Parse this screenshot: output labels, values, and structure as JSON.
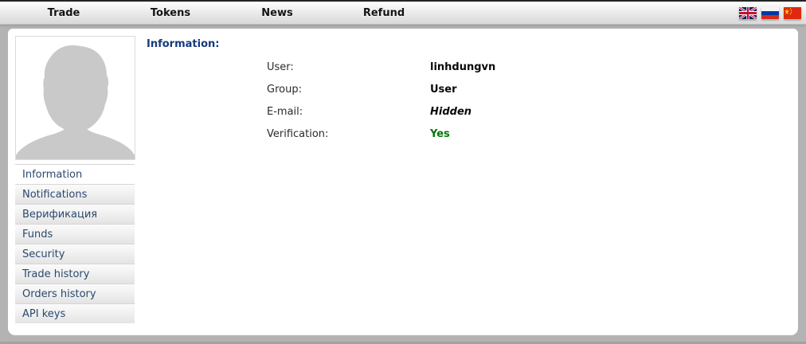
{
  "nav": {
    "items": [
      {
        "label": "Trade"
      },
      {
        "label": "Tokens"
      },
      {
        "label": "News"
      },
      {
        "label": "Refund"
      }
    ],
    "flags": [
      {
        "icon": "uk-flag-icon",
        "language": "English"
      },
      {
        "icon": "russia-flag-icon",
        "language": "Russian"
      },
      {
        "icon": "china-flag-icon",
        "language": "Chinese"
      }
    ]
  },
  "sidebar": {
    "avatar": "placeholder-person-silhouette",
    "items": [
      {
        "label": "Information",
        "active": true
      },
      {
        "label": "Notifications",
        "active": false
      },
      {
        "label": "Верификация",
        "active": false
      },
      {
        "label": "Funds",
        "active": false
      },
      {
        "label": "Security",
        "active": false
      },
      {
        "label": "Trade history",
        "active": false
      },
      {
        "label": "Orders history",
        "active": false
      },
      {
        "label": "API keys",
        "active": false
      }
    ]
  },
  "main": {
    "title": "Information:",
    "fields": [
      {
        "label": "User:",
        "value": "linhdungvn",
        "style": "bold"
      },
      {
        "label": "Group:",
        "value": "User",
        "style": "bold"
      },
      {
        "label": "E-mail:",
        "value": "Hidden",
        "style": "bold-italic"
      },
      {
        "label": "Verification:",
        "value": "Yes",
        "style": "bold-green"
      }
    ]
  },
  "colors": {
    "page_background": "#b3b3b3",
    "panel_background": "#ffffff",
    "heading_blue": "#16397e",
    "sidebar_link_blue": "#2a486e",
    "verification_green": "#067806",
    "nav_text": "#141414"
  }
}
